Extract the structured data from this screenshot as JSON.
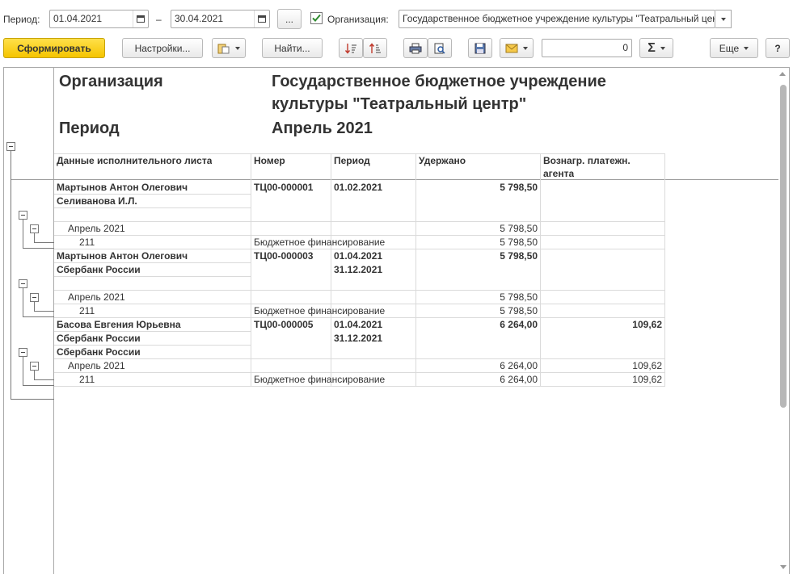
{
  "toolbar_top": {
    "period_label": "Период:",
    "date_from": "01.04.2021",
    "date_to": "30.04.2021",
    "dash": "–",
    "ellipsis": "...",
    "org_checkbox_checked": true,
    "org_label": "Организация:",
    "org_value": "Государственное бюджетное учреждение культуры \"Театральный центр\""
  },
  "toolbar": {
    "generate": "Сформировать",
    "settings": "Настройки...",
    "find": "Найти...",
    "number_value": "0",
    "sum_symbol": "Σ",
    "more": "Еще",
    "help": "?"
  },
  "report": {
    "org_caption": "Организация",
    "org_name_line1": "Государственное бюджетное учреждение",
    "org_name_line2": "культуры \"Театральный центр\"",
    "period_caption": "Период",
    "period_value": "Апрель 2021",
    "columns": [
      "Данные исполнительного листа",
      "Номер",
      "Период",
      "Удержано",
      "Вознагр. платежн.",
      "агента"
    ],
    "groups": [
      {
        "name": "Мартынов Антон Олегович",
        "recipient": "Селиванова И.Л.",
        "number": "ТЦ00-000001",
        "period_from": "01.02.2021",
        "period_to": "",
        "withheld": "5 798,50",
        "fee": "",
        "recipient2": "",
        "month": "Апрель 2021",
        "month_withheld": "5 798,50",
        "month_fee": "",
        "code": "211",
        "financing": "Бюджетное финансирование",
        "code_withheld": "5 798,50",
        "code_fee": ""
      },
      {
        "name": "Мартынов Антон Олегович",
        "recipient": "Сбербанк России",
        "number": "ТЦ00-000003",
        "period_from": "01.04.2021",
        "period_to": "31.12.2021",
        "withheld": "5 798,50",
        "fee": "",
        "recipient2": "",
        "month": "Апрель 2021",
        "month_withheld": "5 798,50",
        "month_fee": "",
        "code": "211",
        "financing": "Бюджетное финансирование",
        "code_withheld": "5 798,50",
        "code_fee": ""
      },
      {
        "name": "Басова Евгения Юрьевна",
        "recipient": "Сбербанк России",
        "number": "ТЦ00-000005",
        "period_from": "01.04.2021",
        "period_to": "31.12.2021",
        "withheld": "6 264,00",
        "fee": "109,62",
        "recipient2": "Сбербанк России",
        "month": "Апрель 2021",
        "month_withheld": "6 264,00",
        "month_fee": "109,62",
        "code": "211",
        "financing": "Бюджетное финансирование",
        "code_withheld": "6 264,00",
        "code_fee": "109,62"
      }
    ]
  },
  "colors": {
    "primary_button": "#f5c400",
    "checkbox_check": "#2e8b2e",
    "border": "#a9a9a9"
  }
}
